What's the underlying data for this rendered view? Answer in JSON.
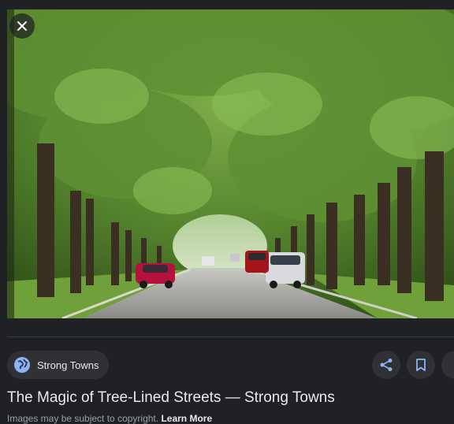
{
  "viewer": {
    "close_icon": "close-icon",
    "image_alt": "Tree-lined street with cars parked along the road"
  },
  "source": {
    "icon": "globe-icon",
    "name": "Strong Towns"
  },
  "actions": {
    "share_icon": "share-icon",
    "save_icon": "bookmark-icon"
  },
  "title": "The Magic of Tree-Lined Streets — Strong Towns",
  "notice": {
    "text": "Images may be subject to copyright.",
    "learn_more": "Learn More"
  },
  "colors": {
    "background": "#202124",
    "chip": "#303134",
    "accent": "#8ab4f8",
    "text": "#e8eaed",
    "muted": "#9aa0a6"
  }
}
